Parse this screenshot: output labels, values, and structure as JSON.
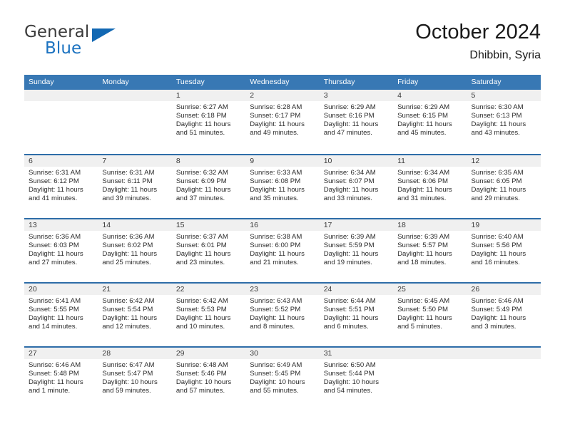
{
  "brand": {
    "line1": "General",
    "line2": "Blue",
    "triangle_icon": "triangle-icon",
    "color_text": "#3b3b3b",
    "color_blue": "#1b72c0"
  },
  "header": {
    "title": "October 2024",
    "subtitle": "Dhibbin, Syria"
  },
  "theme": {
    "header_bg": "#3878b4",
    "row_divider": "#2e6da8",
    "date_band_bg": "#f0f0f0",
    "text": "#2b2b2b"
  },
  "calendar": {
    "weekday_headers": [
      "Sunday",
      "Monday",
      "Tuesday",
      "Wednesday",
      "Thursday",
      "Friday",
      "Saturday"
    ],
    "weeks": [
      [
        {
          "day": "",
          "sunrise": "",
          "sunset": "",
          "daylight": ""
        },
        {
          "day": "",
          "sunrise": "",
          "sunset": "",
          "daylight": ""
        },
        {
          "day": "1",
          "sunrise": "Sunrise: 6:27 AM",
          "sunset": "Sunset: 6:18 PM",
          "daylight": "Daylight: 11 hours and 51 minutes."
        },
        {
          "day": "2",
          "sunrise": "Sunrise: 6:28 AM",
          "sunset": "Sunset: 6:17 PM",
          "daylight": "Daylight: 11 hours and 49 minutes."
        },
        {
          "day": "3",
          "sunrise": "Sunrise: 6:29 AM",
          "sunset": "Sunset: 6:16 PM",
          "daylight": "Daylight: 11 hours and 47 minutes."
        },
        {
          "day": "4",
          "sunrise": "Sunrise: 6:29 AM",
          "sunset": "Sunset: 6:15 PM",
          "daylight": "Daylight: 11 hours and 45 minutes."
        },
        {
          "day": "5",
          "sunrise": "Sunrise: 6:30 AM",
          "sunset": "Sunset: 6:13 PM",
          "daylight": "Daylight: 11 hours and 43 minutes."
        }
      ],
      [
        {
          "day": "6",
          "sunrise": "Sunrise: 6:31 AM",
          "sunset": "Sunset: 6:12 PM",
          "daylight": "Daylight: 11 hours and 41 minutes."
        },
        {
          "day": "7",
          "sunrise": "Sunrise: 6:31 AM",
          "sunset": "Sunset: 6:11 PM",
          "daylight": "Daylight: 11 hours and 39 minutes."
        },
        {
          "day": "8",
          "sunrise": "Sunrise: 6:32 AM",
          "sunset": "Sunset: 6:09 PM",
          "daylight": "Daylight: 11 hours and 37 minutes."
        },
        {
          "day": "9",
          "sunrise": "Sunrise: 6:33 AM",
          "sunset": "Sunset: 6:08 PM",
          "daylight": "Daylight: 11 hours and 35 minutes."
        },
        {
          "day": "10",
          "sunrise": "Sunrise: 6:34 AM",
          "sunset": "Sunset: 6:07 PM",
          "daylight": "Daylight: 11 hours and 33 minutes."
        },
        {
          "day": "11",
          "sunrise": "Sunrise: 6:34 AM",
          "sunset": "Sunset: 6:06 PM",
          "daylight": "Daylight: 11 hours and 31 minutes."
        },
        {
          "day": "12",
          "sunrise": "Sunrise: 6:35 AM",
          "sunset": "Sunset: 6:05 PM",
          "daylight": "Daylight: 11 hours and 29 minutes."
        }
      ],
      [
        {
          "day": "13",
          "sunrise": "Sunrise: 6:36 AM",
          "sunset": "Sunset: 6:03 PM",
          "daylight": "Daylight: 11 hours and 27 minutes."
        },
        {
          "day": "14",
          "sunrise": "Sunrise: 6:36 AM",
          "sunset": "Sunset: 6:02 PM",
          "daylight": "Daylight: 11 hours and 25 minutes."
        },
        {
          "day": "15",
          "sunrise": "Sunrise: 6:37 AM",
          "sunset": "Sunset: 6:01 PM",
          "daylight": "Daylight: 11 hours and 23 minutes."
        },
        {
          "day": "16",
          "sunrise": "Sunrise: 6:38 AM",
          "sunset": "Sunset: 6:00 PM",
          "daylight": "Daylight: 11 hours and 21 minutes."
        },
        {
          "day": "17",
          "sunrise": "Sunrise: 6:39 AM",
          "sunset": "Sunset: 5:59 PM",
          "daylight": "Daylight: 11 hours and 19 minutes."
        },
        {
          "day": "18",
          "sunrise": "Sunrise: 6:39 AM",
          "sunset": "Sunset: 5:57 PM",
          "daylight": "Daylight: 11 hours and 18 minutes."
        },
        {
          "day": "19",
          "sunrise": "Sunrise: 6:40 AM",
          "sunset": "Sunset: 5:56 PM",
          "daylight": "Daylight: 11 hours and 16 minutes."
        }
      ],
      [
        {
          "day": "20",
          "sunrise": "Sunrise: 6:41 AM",
          "sunset": "Sunset: 5:55 PM",
          "daylight": "Daylight: 11 hours and 14 minutes."
        },
        {
          "day": "21",
          "sunrise": "Sunrise: 6:42 AM",
          "sunset": "Sunset: 5:54 PM",
          "daylight": "Daylight: 11 hours and 12 minutes."
        },
        {
          "day": "22",
          "sunrise": "Sunrise: 6:42 AM",
          "sunset": "Sunset: 5:53 PM",
          "daylight": "Daylight: 11 hours and 10 minutes."
        },
        {
          "day": "23",
          "sunrise": "Sunrise: 6:43 AM",
          "sunset": "Sunset: 5:52 PM",
          "daylight": "Daylight: 11 hours and 8 minutes."
        },
        {
          "day": "24",
          "sunrise": "Sunrise: 6:44 AM",
          "sunset": "Sunset: 5:51 PM",
          "daylight": "Daylight: 11 hours and 6 minutes."
        },
        {
          "day": "25",
          "sunrise": "Sunrise: 6:45 AM",
          "sunset": "Sunset: 5:50 PM",
          "daylight": "Daylight: 11 hours and 5 minutes."
        },
        {
          "day": "26",
          "sunrise": "Sunrise: 6:46 AM",
          "sunset": "Sunset: 5:49 PM",
          "daylight": "Daylight: 11 hours and 3 minutes."
        }
      ],
      [
        {
          "day": "27",
          "sunrise": "Sunrise: 6:46 AM",
          "sunset": "Sunset: 5:48 PM",
          "daylight": "Daylight: 11 hours and 1 minute."
        },
        {
          "day": "28",
          "sunrise": "Sunrise: 6:47 AM",
          "sunset": "Sunset: 5:47 PM",
          "daylight": "Daylight: 10 hours and 59 minutes."
        },
        {
          "day": "29",
          "sunrise": "Sunrise: 6:48 AM",
          "sunset": "Sunset: 5:46 PM",
          "daylight": "Daylight: 10 hours and 57 minutes."
        },
        {
          "day": "30",
          "sunrise": "Sunrise: 6:49 AM",
          "sunset": "Sunset: 5:45 PM",
          "daylight": "Daylight: 10 hours and 55 minutes."
        },
        {
          "day": "31",
          "sunrise": "Sunrise: 6:50 AM",
          "sunset": "Sunset: 5:44 PM",
          "daylight": "Daylight: 10 hours and 54 minutes."
        },
        {
          "day": "",
          "sunrise": "",
          "sunset": "",
          "daylight": ""
        },
        {
          "day": "",
          "sunrise": "",
          "sunset": "",
          "daylight": ""
        }
      ]
    ]
  }
}
